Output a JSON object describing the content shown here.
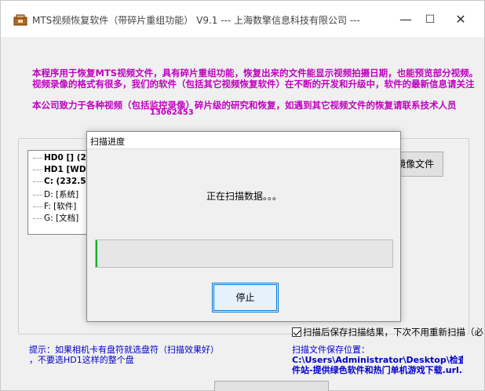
{
  "window": {
    "title": "MTS视频恢复软件（带碎片重组功能） V9.1 --- 上海数擎信息科技有限公司 ---",
    "minimize_glyph": "—",
    "maximize_glyph": "☐",
    "close_glyph": "✕"
  },
  "intro": {
    "line1": "本程序用于恢复MTS视频文件，具有碎片重组功能，恢复出来的文件能显示视频拍摄日期，也能预览部分视频。",
    "line2": "视频录像的格式有很多，我们的软件（包括其它视频恢复软件）在不断的开发和升级中，软件的最新信息请关注",
    "line3": "本公司致力于各种视频（包括监控录像）碎片级的研究和恢复，如遇到其它视频文件的恢复请联系技术人员",
    "line4": "13062453"
  },
  "drives": [
    {
      "text": "HD0  [] (2",
      "bold": true
    },
    {
      "text": "HD1  [WD",
      "bold": true
    },
    {
      "text": "C:  (232.5",
      "bold": true
    },
    {
      "text": "D:  [系统]",
      "bold": false
    },
    {
      "text": "F:  [软件]",
      "bold": false
    },
    {
      "text": "G:  [文档]",
      "bold": false
    }
  ],
  "buttons": {
    "image_file": "镜像文件"
  },
  "options": {
    "save_scan_result_label": "扫描后保存扫描结果，下次不用重新扫描（必",
    "save_scan_result_checked": true
  },
  "hint": {
    "line1": "提示：如果相机卡有盘符就选盘符（扫描效果好）",
    "line2": "，不要选HD1这样的整个盘"
  },
  "save_path": {
    "label": "扫描文件保存位置：",
    "path": "C:\\Users\\Administrator\\Desktop\\检查包\\多多",
    "extra": "件站-提供绿色软件和热门单机游戏下载.url.mtsi"
  },
  "dialog": {
    "title": "扫描进度",
    "status": "正在扫描数据。。。",
    "progress": 0.005,
    "stop_label": "停止"
  },
  "colors": {
    "intro_text": "#c000c0",
    "hint_text": "#0000c8",
    "progress_fill": "#06b025",
    "focus_border": "#0078d7"
  }
}
